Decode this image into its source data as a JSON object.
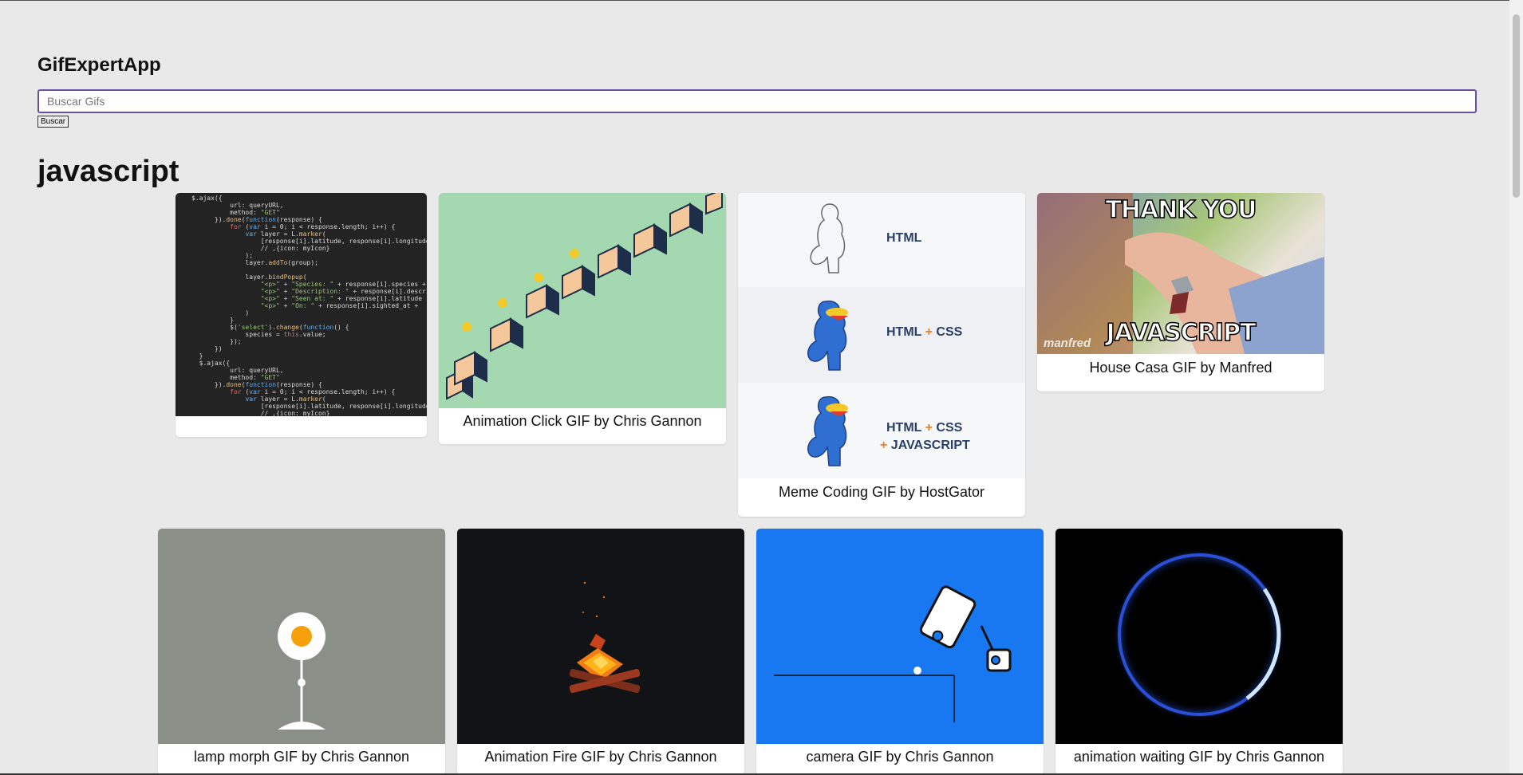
{
  "app": {
    "title": "GifExpertApp"
  },
  "search": {
    "placeholder": "Buscar Gifs",
    "button_label": "Buscar"
  },
  "category": {
    "title": "javascript",
    "gifs": [
      {
        "caption": "",
        "image": "javascript-code-editor"
      },
      {
        "caption": "Animation Click GIF by Chris Gannon",
        "image": "boxes-on-green"
      },
      {
        "caption": "Meme Coding GIF by HostGator",
        "image": "hostgator-html-css-js",
        "labels": [
          "HTML",
          "HTML + CSS",
          "HTML + CSS",
          "+ JAVASCRIPT"
        ]
      },
      {
        "caption": "House Casa GIF by Manfred",
        "image": "thank-you-javascript-keys",
        "labels": [
          "THANK YOU",
          "JAVASCRIPT",
          "manfred"
        ]
      },
      {
        "caption": "lamp morph GIF by Chris Gannon",
        "image": "lamp-on-grey"
      },
      {
        "caption": "Animation Fire GIF by Chris Gannon",
        "image": "campfire-on-dark"
      },
      {
        "caption": "camera GIF by Chris Gannon",
        "image": "security-camera-on-blue"
      },
      {
        "caption": "animation waiting GIF by Chris Gannon",
        "image": "blue-ring-on-black"
      }
    ]
  }
}
